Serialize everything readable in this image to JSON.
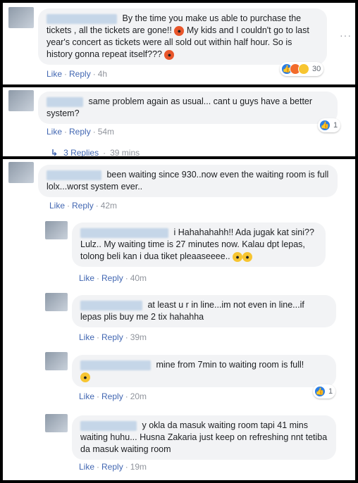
{
  "comments": [
    {
      "text_a": "By the time you make us able to purchase the tickets , all the tickets are gone!! ",
      "text_b": "My kids and I couldn't go to last year's concert as tickets were all sold out within half hour. So is history gonna repeat itself??? ",
      "like": "Like",
      "reply": "Reply",
      "time": "4h",
      "reaction_count": "30",
      "more_options": "···"
    },
    {
      "text": "same problem again as usual... cant u guys have a better system?",
      "like": "Like",
      "reply": "Reply",
      "time": "54m",
      "reaction_count": "1",
      "replies_label": "3 Replies",
      "replies_time": "39 mins"
    },
    {
      "text": "been waiting since 930..now even the waiting room is full lolx...worst system ever..",
      "like": "Like",
      "reply": "Reply",
      "time": "42m"
    }
  ],
  "replies": [
    {
      "text": "i Hahahahahh!! Ada jugak kat sini?? Lulz.. My waiting time is 27 minutes now. Kalau dpt lepas, tolong beli kan i dua tiket pleaaseeee.. ",
      "like": "Like",
      "reply": "Reply",
      "time": "40m"
    },
    {
      "text": "at least u r in line...im not even in line...if lepas plis buy me 2 tix hahahha",
      "like": "Like",
      "reply": "Reply",
      "time": "39m"
    },
    {
      "text": "mine from 7min to waiting room is full!",
      "like": "Like",
      "reply": "Reply",
      "time": "20m",
      "reaction_count": "1"
    },
    {
      "text": "y okla da masuk waiting room tapi 41 mins waiting huhu... Husna Zakaria just keep on refreshing nnt tetiba da masuk waiting room",
      "like": "Like",
      "reply": "Reply",
      "time": "19m"
    }
  ],
  "separator": "·",
  "colors": {
    "link": "#4267b2",
    "meta": "#90949c",
    "bubble": "#f2f3f5",
    "like_blue": "#2b7fe5"
  }
}
